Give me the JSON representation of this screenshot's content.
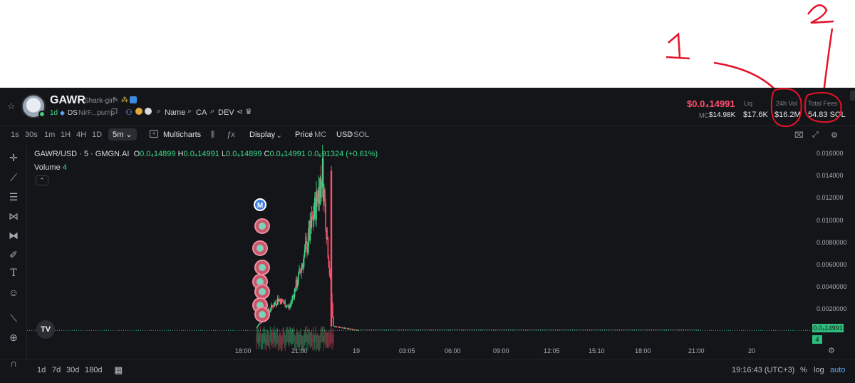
{
  "annotations": {
    "label_one": "1",
    "label_two": "2"
  },
  "token": {
    "ticker": "GAWR",
    "name": "Shark-girl",
    "age": "1d",
    "ds": "DS",
    "address": "NirF...pump",
    "links": [
      "Name",
      "CA",
      "DEV"
    ]
  },
  "stats": {
    "price": "$0.0₄14991",
    "mc_label": "MC",
    "mc_value": "$14.98K",
    "liq_label": "Liq",
    "liq_value": "$17.6K",
    "vol_label": "24h Vol",
    "vol_value": "$16.2M",
    "fees_label": "Total Fees",
    "fees_value": "54.83 SOL"
  },
  "toolbar": {
    "timeframes": [
      "1s",
      "30s",
      "1m",
      "1H",
      "4H",
      "1D"
    ],
    "active_timeframe": "5m",
    "multicharts": "Multicharts",
    "display": "Display",
    "price": "Price",
    "mc": "MC",
    "usd": "USD",
    "sol": "SOL"
  },
  "legend": {
    "pair": "GAWR/USD · 5 · GMGN.AI",
    "o": "O",
    "o_val": "0.0₄14899",
    "h": "H",
    "h_val": "0.0₄14991",
    "l": "L",
    "l_val": "0.0₄14899",
    "c": "C",
    "c_val": "0.0₄14991",
    "change": "0.0₆91324 (+0.61%)",
    "volume_label": "Volume",
    "volume_value": "4"
  },
  "axis": {
    "y_labels": [
      "0.016000",
      "0.014000",
      "0.012000",
      "0.010000",
      "0.0080000",
      "0.0060000",
      "0.0040000",
      "0.0020000"
    ],
    "x_labels": [
      "18:00",
      "21:00",
      "19",
      "03:05",
      "06:00",
      "09:00",
      "12:05",
      "15:10",
      "18:00",
      "21:00",
      "20"
    ],
    "price_badge": "0.0₄14991",
    "vol_badge": "4"
  },
  "bottom": {
    "ranges": [
      "1d",
      "7d",
      "30d",
      "180d"
    ],
    "time": "19:16:43 (UTC+3)",
    "percent": "%",
    "log": "log",
    "auto": "auto"
  },
  "colors": {
    "up": "#39d98a",
    "down": "#ff4d6d",
    "bg": "#141518"
  },
  "chart_data": {
    "type": "candlestick",
    "y_range": [
      0,
      0.016
    ],
    "candles_summary": [
      {
        "t": "17:40",
        "price": 0.0004
      },
      {
        "t": "18:30",
        "price": 0.0018
      },
      {
        "t": "19:00",
        "price": 0.003
      },
      {
        "t": "19:30",
        "price": 0.0022
      },
      {
        "t": "20:00",
        "price": 0.0055
      },
      {
        "t": "20:30",
        "price": 0.0095
      },
      {
        "t": "20:50",
        "price": 0.0145
      },
      {
        "t": "21:00",
        "price": 0.0005
      },
      {
        "t": "21:10",
        "price": 0.00015
      }
    ]
  }
}
